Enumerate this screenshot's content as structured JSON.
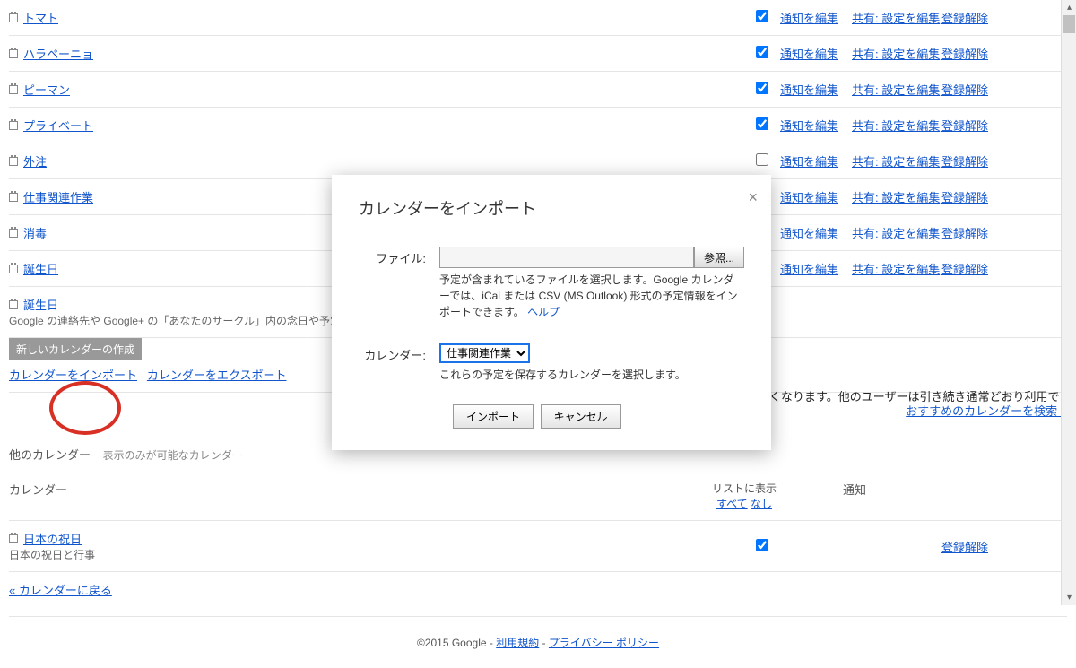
{
  "calendars": [
    {
      "name": "トマト",
      "checked": true,
      "notify": "通知を編集",
      "share": "共有: 設定を編集",
      "unreg": "登録解除"
    },
    {
      "name": "ハラペーニョ",
      "checked": true,
      "notify": "通知を編集",
      "share": "共有: 設定を編集",
      "unreg": "登録解除"
    },
    {
      "name": "ピーマン",
      "checked": true,
      "notify": "通知を編集",
      "share": "共有: 設定を編集",
      "unreg": "登録解除"
    },
    {
      "name": "プライベート",
      "checked": true,
      "notify": "通知を編集",
      "share": "共有: 設定を編集",
      "unreg": "登録解除"
    },
    {
      "name": "外注",
      "checked": false,
      "notify": "通知を編集",
      "share": "共有: 設定を編集",
      "unreg": "登録解除"
    },
    {
      "name": "仕事関連作業",
      "checked": false,
      "notify": "通知を編集",
      "share": "共有: 設定を編集",
      "unreg": "登録解除"
    },
    {
      "name": "消毒",
      "checked": false,
      "notify": "通知を編集",
      "share": "共有: 設定を編集",
      "unreg": "登録解除"
    },
    {
      "name": "誕生日",
      "checked": false,
      "notify": "通知を編集",
      "share": "共有: 設定を編集",
      "unreg": "登録解除"
    }
  ],
  "birthday_section": {
    "title": "誕生日",
    "desc": "Google の連絡先や Google+ の「あなたのサークル」内の念日や予定があれば、それも表示されます。"
  },
  "actions": {
    "create": "新しいカレンダーの作成",
    "import": "カレンダーをインポート",
    "export": "カレンダーをエクスポート",
    "overflow": "くなります。他のユーザーは引き続き通常どおり利用でき"
  },
  "recommend": "おすすめのカレンダーを検索 »",
  "other_section": {
    "label": "他のカレンダー",
    "note": "表示のみが可能なカレンダー"
  },
  "headers": {
    "calendar": "カレンダー",
    "list": "リストに表示",
    "all": "すべて",
    "none": "なし",
    "notify": "通知"
  },
  "other_calendars": [
    {
      "name": "日本の祝日",
      "desc": "日本の祝日と行事",
      "checked": true,
      "unreg": "登録解除"
    }
  ],
  "back": "« カレンダーに戻る",
  "footer": {
    "copyright": "©2015 Google - ",
    "terms": "利用規約",
    "sep": " - ",
    "privacy": "プライバシー ポリシー"
  },
  "modal": {
    "title": "カレンダーをインポート",
    "file_label": "ファイル:",
    "browse": "参照...",
    "file_help1": "予定が含まれているファイルを選択します。Google カレンダーでは、iCal または CSV (MS Outlook) 形式の予定情報をインポートできます。",
    "help_link": "ヘルプ",
    "cal_label": "カレンダー:",
    "cal_selected": "仕事関連作業",
    "cal_help": "これらの予定を保存するカレンダーを選択します。",
    "import_btn": "インポート",
    "cancel_btn": "キャンセル"
  }
}
